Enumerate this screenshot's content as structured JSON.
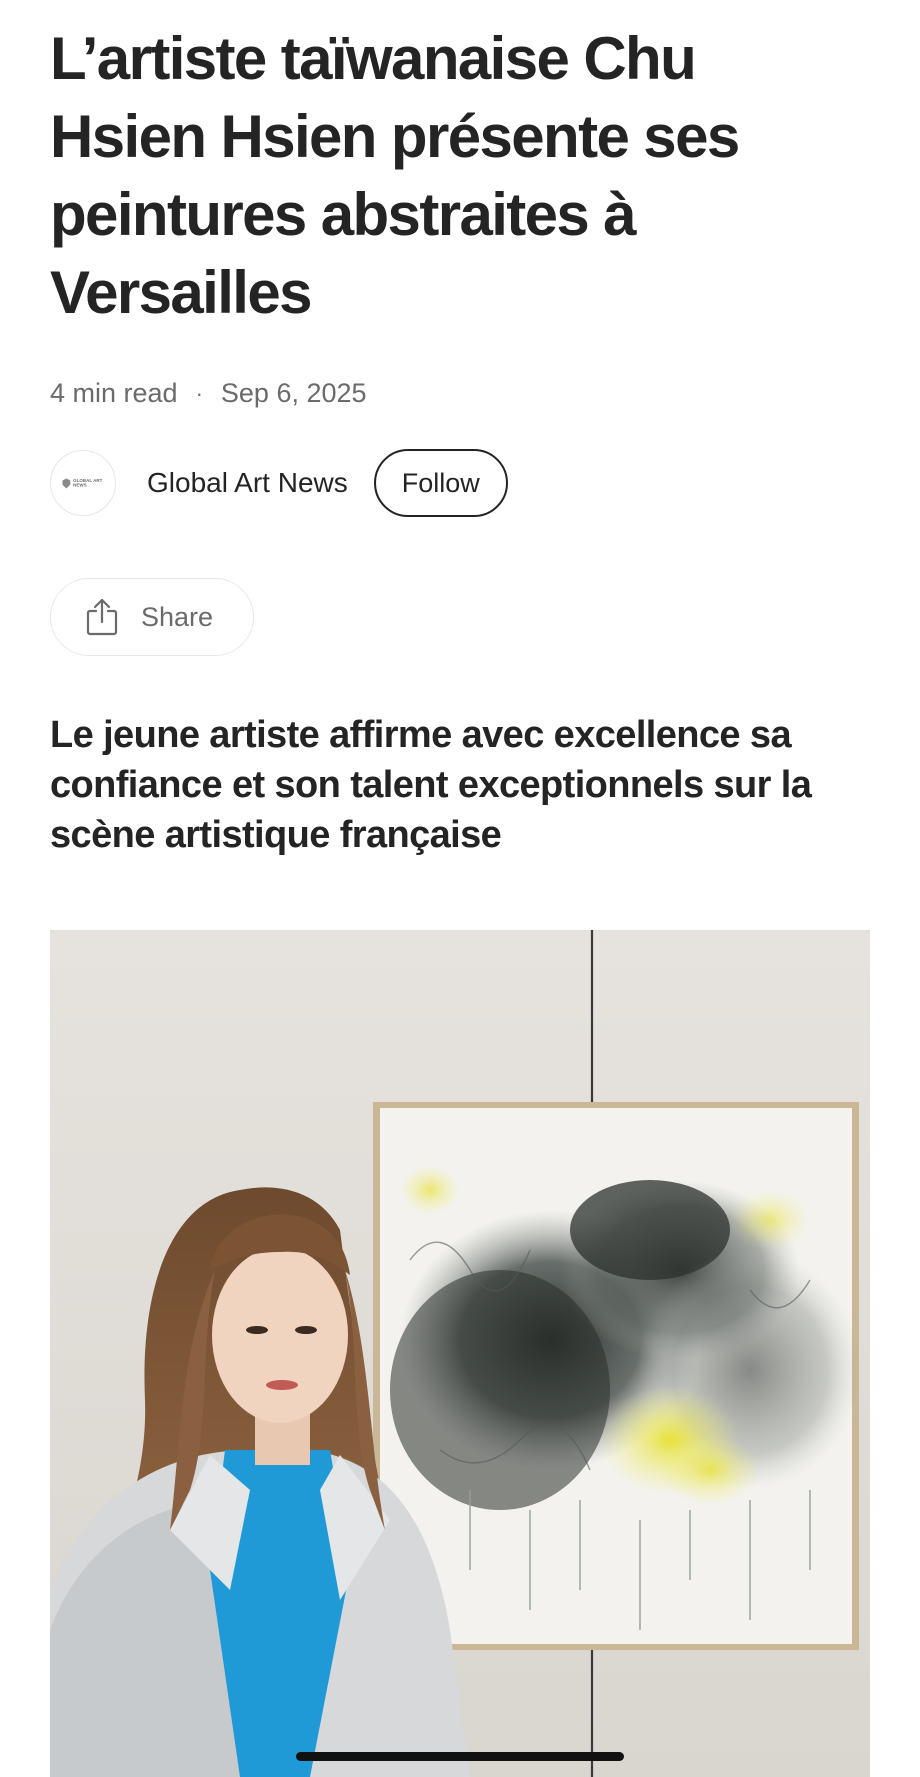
{
  "article": {
    "title": "L’artiste taïwanaise Chu Hsien Hsien présente ses peintures abstraites à Versailles",
    "read_time": "4 min read",
    "separator": "·",
    "date": "Sep 6, 2025",
    "subtitle": "Le jeune artiste affirme avec excellence sa confiance et son talent exceptionnels sur la scène artistique française"
  },
  "author": {
    "name": "Global Art News",
    "avatar_text": "GLOBAL ART NEWS",
    "avatar_icon": "shield-icon"
  },
  "actions": {
    "follow_label": "Follow",
    "share_label": "Share",
    "share_icon": "share-icon"
  },
  "colors": {
    "text_primary": "#242424",
    "text_secondary": "#6b6b6b",
    "border_light": "#e8e8e8"
  }
}
